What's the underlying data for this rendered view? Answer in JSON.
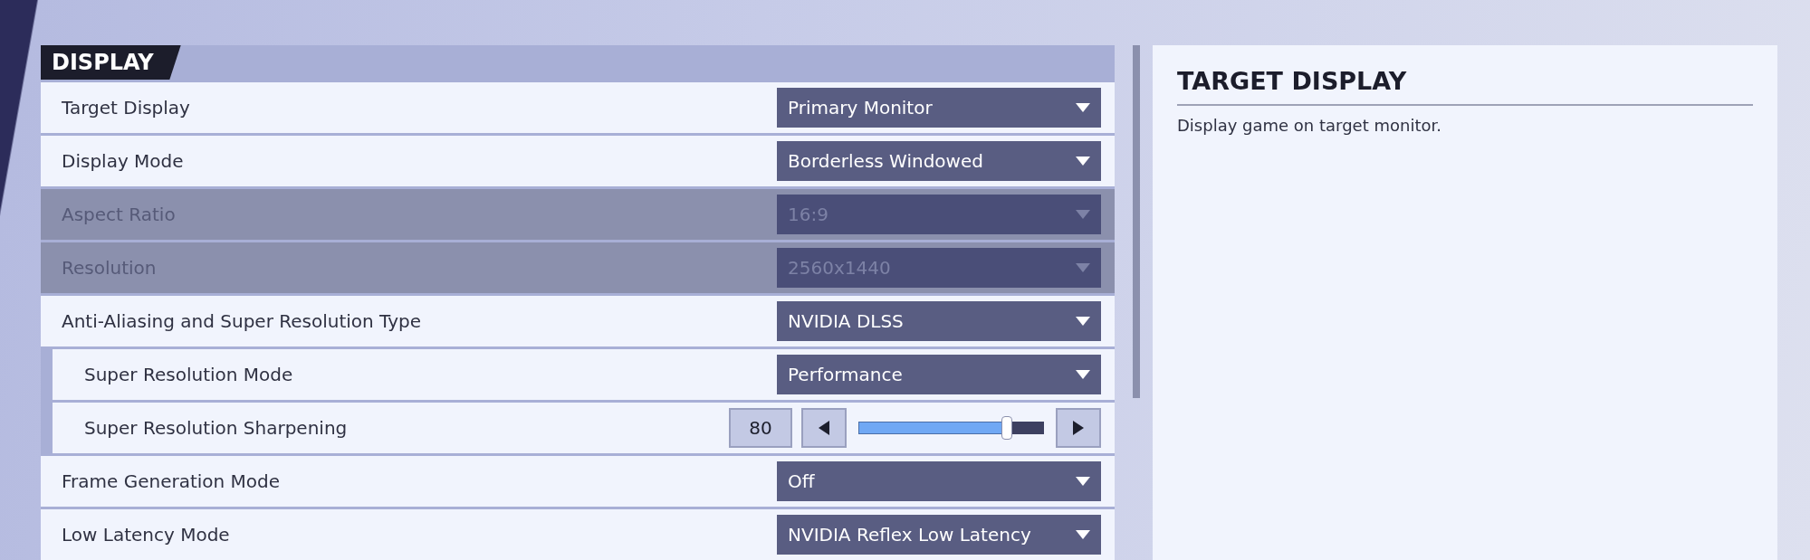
{
  "section": {
    "title": "DISPLAY"
  },
  "settings": [
    {
      "kind": "dropdown",
      "label": "Target Display",
      "value": "Primary Monitor",
      "disabled": false
    },
    {
      "kind": "dropdown",
      "label": "Display Mode",
      "value": "Borderless Windowed",
      "disabled": false
    },
    {
      "kind": "dropdown",
      "label": "Aspect Ratio",
      "value": "16:9",
      "disabled": true
    },
    {
      "kind": "dropdown",
      "label": "Resolution",
      "value": "2560x1440",
      "disabled": true
    },
    {
      "kind": "dropdown",
      "label": "Anti-Aliasing and Super Resolution Type",
      "value": "NVIDIA DLSS",
      "disabled": false,
      "children": [
        {
          "kind": "dropdown",
          "label": "Super Resolution Mode",
          "value": "Performance",
          "disabled": false
        },
        {
          "kind": "slider",
          "label": "Super Resolution Sharpening",
          "value": "80",
          "level": 0.8,
          "disabled": false
        }
      ]
    },
    {
      "kind": "dropdown",
      "label": "Frame Generation Mode",
      "value": "Off",
      "disabled": false
    },
    {
      "kind": "dropdown",
      "label": "Low Latency Mode",
      "value": "NVIDIA Reflex Low Latency",
      "disabled": false
    }
  ],
  "detail": {
    "title": "TARGET DISPLAY",
    "description": "Display game on target monitor."
  }
}
